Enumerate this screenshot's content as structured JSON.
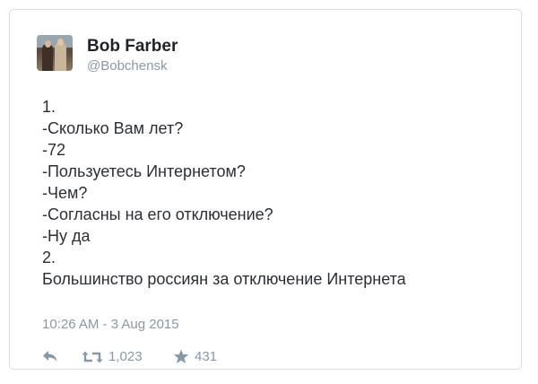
{
  "author": {
    "name": "Bob Farber",
    "handle": "@Bobchensk"
  },
  "tweet": {
    "lines": [
      "1.",
      "-Сколько Вам лет?",
      "-72",
      "-Пользуетесь Интернетом?",
      "-Чем?",
      "-Согласны на его отключение?",
      "-Ну да",
      "2.",
      "Большинство россиян за отключение Интернета"
    ],
    "timestamp": "10:26 AM - 3 Aug 2015"
  },
  "actions": {
    "reply_icon": "reply-icon",
    "retweet_icon": "retweet-icon",
    "retweet_count": "1,023",
    "favorite_icon": "star-icon",
    "favorite_count": "431"
  },
  "colors": {
    "text": "#2b2f33",
    "muted": "#8899a6",
    "border": "#d9dee3"
  }
}
